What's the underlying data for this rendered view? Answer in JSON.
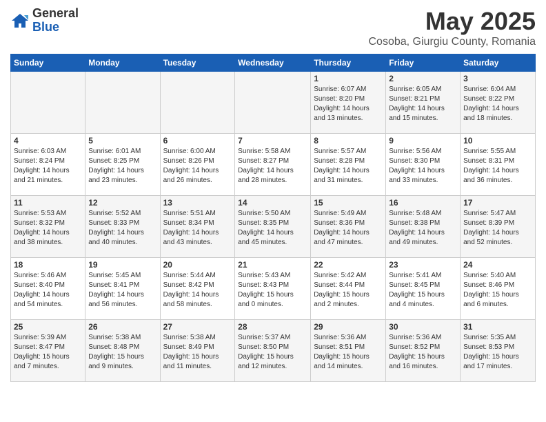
{
  "header": {
    "logo_general": "General",
    "logo_blue": "Blue",
    "title": "May 2025",
    "subtitle": "Cosoba, Giurgiu County, Romania"
  },
  "calendar": {
    "headers": [
      "Sunday",
      "Monday",
      "Tuesday",
      "Wednesday",
      "Thursday",
      "Friday",
      "Saturday"
    ],
    "weeks": [
      [
        {
          "day": "",
          "info": ""
        },
        {
          "day": "",
          "info": ""
        },
        {
          "day": "",
          "info": ""
        },
        {
          "day": "",
          "info": ""
        },
        {
          "day": "1",
          "info": "Sunrise: 6:07 AM\nSunset: 8:20 PM\nDaylight: 14 hours\nand 13 minutes."
        },
        {
          "day": "2",
          "info": "Sunrise: 6:05 AM\nSunset: 8:21 PM\nDaylight: 14 hours\nand 15 minutes."
        },
        {
          "day": "3",
          "info": "Sunrise: 6:04 AM\nSunset: 8:22 PM\nDaylight: 14 hours\nand 18 minutes."
        }
      ],
      [
        {
          "day": "4",
          "info": "Sunrise: 6:03 AM\nSunset: 8:24 PM\nDaylight: 14 hours\nand 21 minutes."
        },
        {
          "day": "5",
          "info": "Sunrise: 6:01 AM\nSunset: 8:25 PM\nDaylight: 14 hours\nand 23 minutes."
        },
        {
          "day": "6",
          "info": "Sunrise: 6:00 AM\nSunset: 8:26 PM\nDaylight: 14 hours\nand 26 minutes."
        },
        {
          "day": "7",
          "info": "Sunrise: 5:58 AM\nSunset: 8:27 PM\nDaylight: 14 hours\nand 28 minutes."
        },
        {
          "day": "8",
          "info": "Sunrise: 5:57 AM\nSunset: 8:28 PM\nDaylight: 14 hours\nand 31 minutes."
        },
        {
          "day": "9",
          "info": "Sunrise: 5:56 AM\nSunset: 8:30 PM\nDaylight: 14 hours\nand 33 minutes."
        },
        {
          "day": "10",
          "info": "Sunrise: 5:55 AM\nSunset: 8:31 PM\nDaylight: 14 hours\nand 36 minutes."
        }
      ],
      [
        {
          "day": "11",
          "info": "Sunrise: 5:53 AM\nSunset: 8:32 PM\nDaylight: 14 hours\nand 38 minutes."
        },
        {
          "day": "12",
          "info": "Sunrise: 5:52 AM\nSunset: 8:33 PM\nDaylight: 14 hours\nand 40 minutes."
        },
        {
          "day": "13",
          "info": "Sunrise: 5:51 AM\nSunset: 8:34 PM\nDaylight: 14 hours\nand 43 minutes."
        },
        {
          "day": "14",
          "info": "Sunrise: 5:50 AM\nSunset: 8:35 PM\nDaylight: 14 hours\nand 45 minutes."
        },
        {
          "day": "15",
          "info": "Sunrise: 5:49 AM\nSunset: 8:36 PM\nDaylight: 14 hours\nand 47 minutes."
        },
        {
          "day": "16",
          "info": "Sunrise: 5:48 AM\nSunset: 8:38 PM\nDaylight: 14 hours\nand 49 minutes."
        },
        {
          "day": "17",
          "info": "Sunrise: 5:47 AM\nSunset: 8:39 PM\nDaylight: 14 hours\nand 52 minutes."
        }
      ],
      [
        {
          "day": "18",
          "info": "Sunrise: 5:46 AM\nSunset: 8:40 PM\nDaylight: 14 hours\nand 54 minutes."
        },
        {
          "day": "19",
          "info": "Sunrise: 5:45 AM\nSunset: 8:41 PM\nDaylight: 14 hours\nand 56 minutes."
        },
        {
          "day": "20",
          "info": "Sunrise: 5:44 AM\nSunset: 8:42 PM\nDaylight: 14 hours\nand 58 minutes."
        },
        {
          "day": "21",
          "info": "Sunrise: 5:43 AM\nSunset: 8:43 PM\nDaylight: 15 hours\nand 0 minutes."
        },
        {
          "day": "22",
          "info": "Sunrise: 5:42 AM\nSunset: 8:44 PM\nDaylight: 15 hours\nand 2 minutes."
        },
        {
          "day": "23",
          "info": "Sunrise: 5:41 AM\nSunset: 8:45 PM\nDaylight: 15 hours\nand 4 minutes."
        },
        {
          "day": "24",
          "info": "Sunrise: 5:40 AM\nSunset: 8:46 PM\nDaylight: 15 hours\nand 6 minutes."
        }
      ],
      [
        {
          "day": "25",
          "info": "Sunrise: 5:39 AM\nSunset: 8:47 PM\nDaylight: 15 hours\nand 7 minutes."
        },
        {
          "day": "26",
          "info": "Sunrise: 5:38 AM\nSunset: 8:48 PM\nDaylight: 15 hours\nand 9 minutes."
        },
        {
          "day": "27",
          "info": "Sunrise: 5:38 AM\nSunset: 8:49 PM\nDaylight: 15 hours\nand 11 minutes."
        },
        {
          "day": "28",
          "info": "Sunrise: 5:37 AM\nSunset: 8:50 PM\nDaylight: 15 hours\nand 12 minutes."
        },
        {
          "day": "29",
          "info": "Sunrise: 5:36 AM\nSunset: 8:51 PM\nDaylight: 15 hours\nand 14 minutes."
        },
        {
          "day": "30",
          "info": "Sunrise: 5:36 AM\nSunset: 8:52 PM\nDaylight: 15 hours\nand 16 minutes."
        },
        {
          "day": "31",
          "info": "Sunrise: 5:35 AM\nSunset: 8:53 PM\nDaylight: 15 hours\nand 17 minutes."
        }
      ]
    ]
  }
}
